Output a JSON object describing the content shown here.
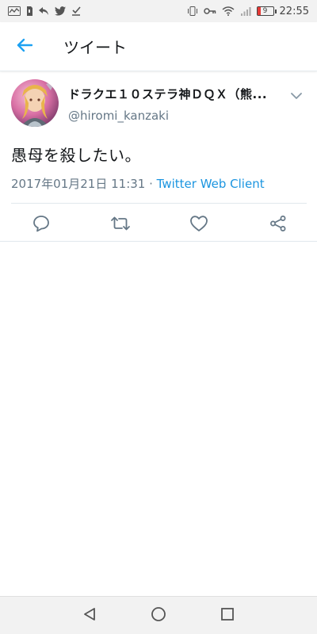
{
  "status_bar": {
    "time": "22:55",
    "battery_level": "9",
    "left_icons": [
      "activity-icon",
      "sim-icon",
      "reply-icon",
      "twitter-bird-icon",
      "download-check-icon"
    ],
    "right_icons": [
      "vibrate-icon",
      "key-icon",
      "wifi-icon",
      "signal-icon",
      "battery-icon"
    ]
  },
  "header": {
    "title": "ツイート",
    "back_icon": "arrow-left-icon"
  },
  "tweet": {
    "author_name": "ドラクエ１０ステラ神ＤＱＸ（熊...",
    "author_handle": "@hiromi_kanzaki",
    "text": "愚母を殺したい。",
    "timestamp": "2017年01月21日 11:31",
    "separator": " · ",
    "source": "Twitter Web Client"
  },
  "actions": {
    "reply_icon": "reply-bubble-icon",
    "retweet_icon": "retweet-icon",
    "like_icon": "heart-icon",
    "share_icon": "share-icon"
  },
  "nav_bar": {
    "back": "triangle-back-icon",
    "home": "circle-home-icon",
    "recents": "square-recents-icon"
  },
  "colors": {
    "accent": "#1da1f2",
    "link": "#1b95e0",
    "secondary_text": "#657786",
    "primary_text": "#14171a",
    "divider": "#e1e8ed"
  }
}
